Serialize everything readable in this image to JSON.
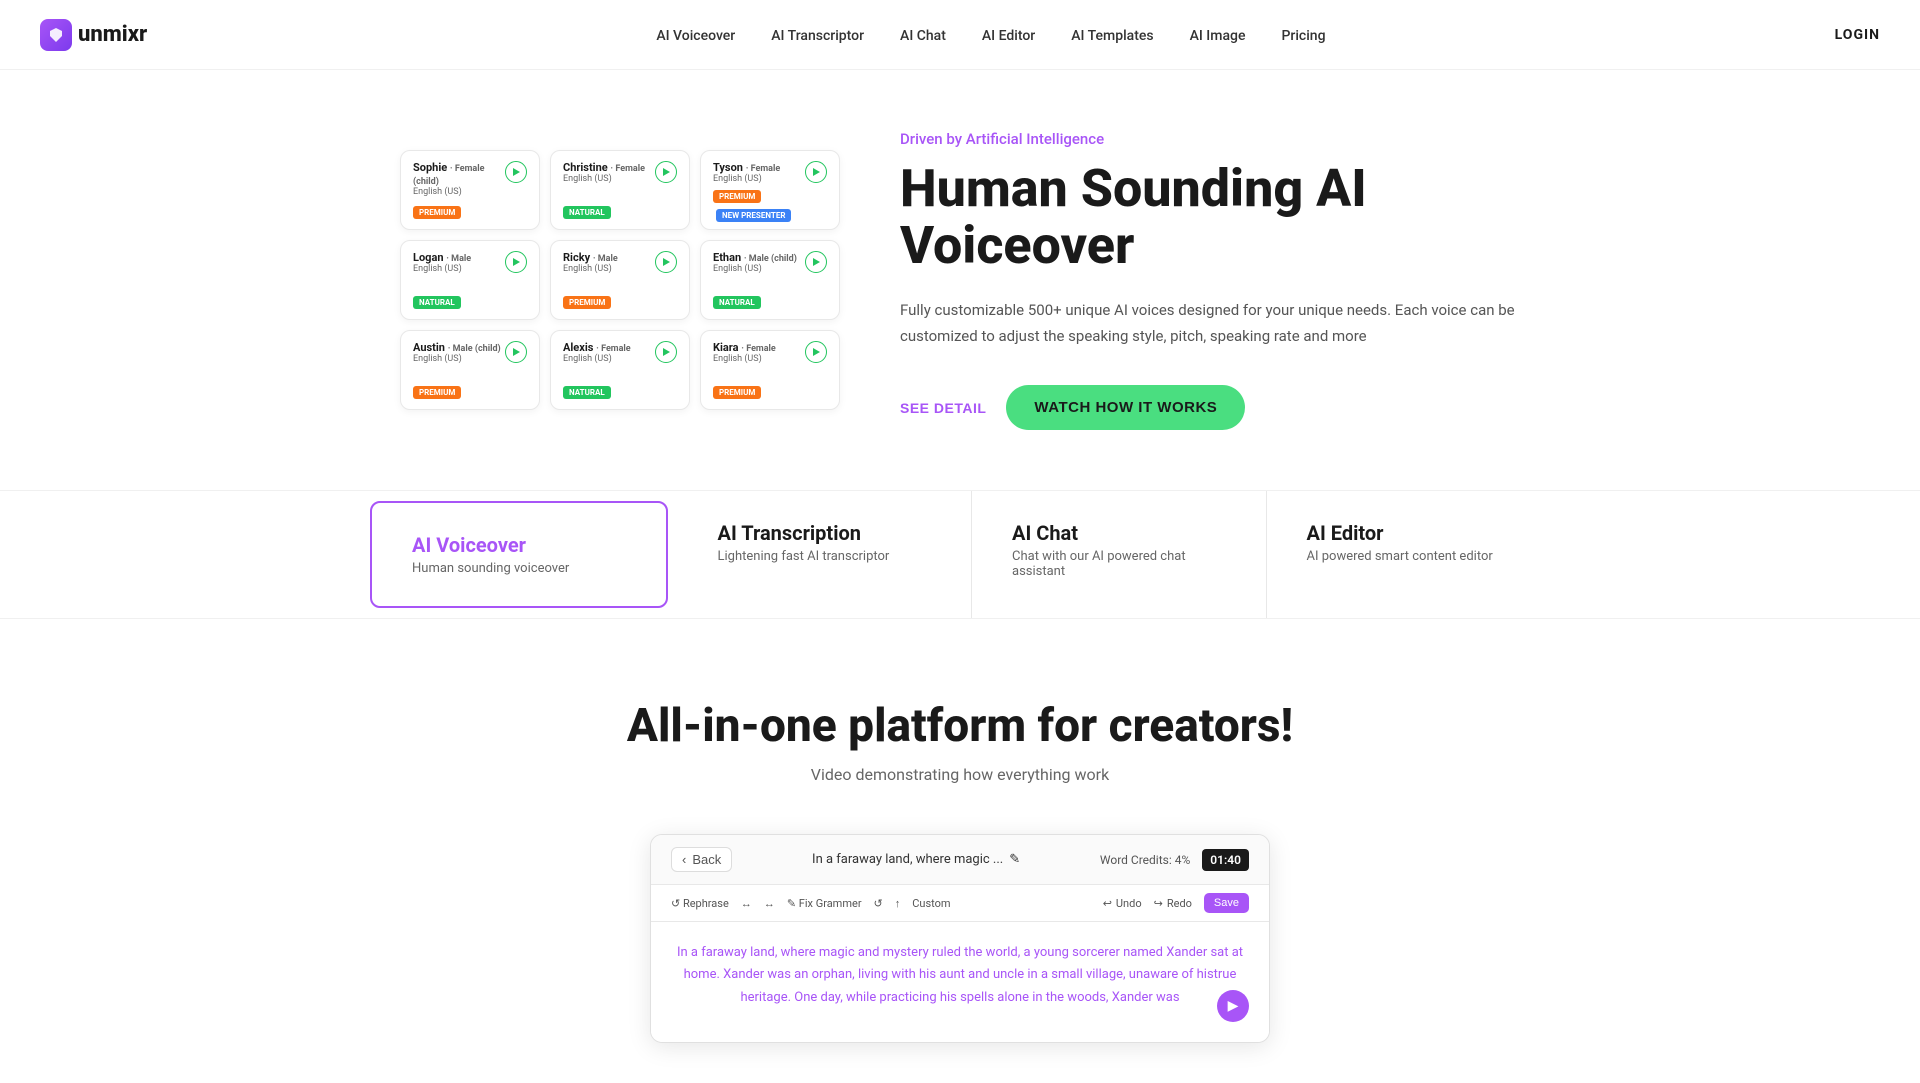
{
  "logo": {
    "text": "unmixr",
    "icon": "U"
  },
  "navbar": {
    "links": [
      {
        "id": "ai-voiceover",
        "label": "AI Voiceover"
      },
      {
        "id": "ai-transcriptor",
        "label": "AI Transcriptor"
      },
      {
        "id": "ai-chat",
        "label": "AI Chat"
      },
      {
        "id": "ai-editor",
        "label": "AI Editor"
      },
      {
        "id": "ai-templates",
        "label": "AI Templates"
      },
      {
        "id": "ai-image",
        "label": "AI Image"
      },
      {
        "id": "pricing",
        "label": "Pricing"
      }
    ],
    "login_label": "LOGIN"
  },
  "hero": {
    "subtitle": "Driven by Artificial Intelligence",
    "title": "Human Sounding AI Voiceover",
    "description": "Fully customizable 500+ unique AI voices designed for your unique needs. Each voice can be customized to adjust the speaking style, pitch, speaking rate and more",
    "see_detail_label": "SEE DETAIL",
    "watch_label": "WATCH HOW IT WORKS"
  },
  "voice_cards": [
    {
      "name": "Sophie",
      "gender_age": "Female (child)",
      "lang": "English (US)",
      "badge": "PREMIUM",
      "badge_type": "premium"
    },
    {
      "name": "Christine",
      "gender_age": "Female",
      "lang": "English (US)",
      "badge": "NATURAL",
      "badge_type": "natural"
    },
    {
      "name": "Tyson",
      "gender_age": "Female",
      "lang": "English (US)",
      "badge": "PREMIUM",
      "badge_type": "premium",
      "badge2": "NEW PRESENTER",
      "badge2_type": "new"
    },
    {
      "name": "Logan",
      "gender_age": "Male",
      "lang": "English (US)",
      "badge": "NATURAL",
      "badge_type": "natural"
    },
    {
      "name": "Ricky",
      "gender_age": "Male",
      "lang": "English (US)",
      "badge": "PREMIUM",
      "badge_type": "premium"
    },
    {
      "name": "Ethan",
      "gender_age": "Male (child)",
      "lang": "English (US)",
      "badge": "NATURAL",
      "badge_type": "natural"
    },
    {
      "name": "Austin",
      "gender_age": "Male (child)",
      "lang": "English (US)",
      "badge": "PREMIUM",
      "badge_type": "premium"
    },
    {
      "name": "Alexis",
      "gender_age": "Female",
      "lang": "English (US)",
      "badge": "NATURAL",
      "badge_type": "natural"
    },
    {
      "name": "Kiara",
      "gender_age": "Female",
      "lang": "English (US)",
      "badge": "PREMIUM",
      "badge_type": "premium"
    }
  ],
  "features": {
    "tabs": [
      {
        "id": "voiceover",
        "title": "AI Voiceover",
        "desc": "Human sounding voiceover",
        "active": true
      },
      {
        "id": "transcription",
        "title": "AI Transcription",
        "desc": "Lightening fast AI transcriptor",
        "active": false
      },
      {
        "id": "chat",
        "title": "AI Chat",
        "desc": "Chat with our AI powered chat assistant",
        "active": false
      },
      {
        "id": "editor",
        "title": "AI Editor",
        "desc": "AI powered smart content editor",
        "active": false
      }
    ]
  },
  "platform": {
    "title": "All-in-one platform for creators!",
    "subtitle": "Video demonstrating how everything work"
  },
  "video_mockup": {
    "back_label": "Back",
    "title": "In a faraway land, where magic ...",
    "edit_icon": "✎",
    "timer": "01:40",
    "word_credits_label": "Word Credits:",
    "word_credits_value": "4%",
    "toolbar_items": [
      "Rephrase",
      "↔",
      "↔",
      "Fix Grammer",
      "↺",
      "↑",
      "Custom"
    ],
    "undo_label": "Undo",
    "redo_label": "Redo",
    "save_label": "Save",
    "content_text": "In a faraway land, where magic and mystery ruled the world, a young sorcerer named Xander sat at home. Xander was an orphan, living with his aunt and uncle in a small village, unaware of histrue heritage. One day, while practicing his spells alone in the woods, Xander was"
  }
}
